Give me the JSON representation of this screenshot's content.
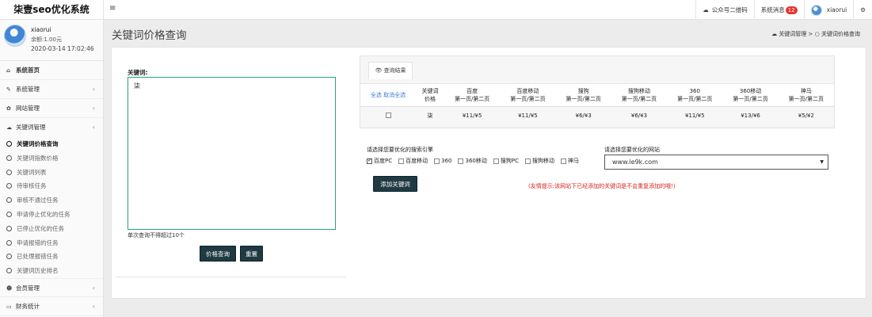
{
  "brand": "柒壹seo优化系统",
  "topbar": {
    "menu_icon": "≡",
    "qrcode": "公众号二维码",
    "messages": "系统消息",
    "messages_count": "12",
    "username": "xiaorui"
  },
  "profile": {
    "name": "xiaorui",
    "balance": "余额:1.00元",
    "time": "2020-03-14 17:02:46"
  },
  "sidebar": {
    "items": [
      {
        "label": "系统首页"
      },
      {
        "label": "系统管理"
      },
      {
        "label": "网站管理"
      },
      {
        "label": "关键词管理"
      }
    ],
    "subitems": [
      {
        "label": "关键词价格查询"
      },
      {
        "label": "关键词指数价格"
      },
      {
        "label": "关键词列表"
      },
      {
        "label": "待审核任务"
      },
      {
        "label": "审核不通过任务"
      },
      {
        "label": "申请停止优化的任务"
      },
      {
        "label": "已停止优化的任务"
      },
      {
        "label": "申请报错的任务"
      },
      {
        "label": "已处理报错任务"
      },
      {
        "label": "关键词历史排名"
      }
    ],
    "bottom_items": [
      {
        "label": "会员管理"
      },
      {
        "label": "财务统计"
      }
    ]
  },
  "page": {
    "title": "关键词价格查询",
    "breadcrumb_parent": "关键词管理",
    "breadcrumb_sep": ">",
    "breadcrumb_current": "关键词价格查询"
  },
  "form": {
    "keyword_label": "关键词:",
    "keyword_value": "柒",
    "help_text": "单次查询不得超过10个",
    "query_button": "价格查询",
    "reset_button": "重置"
  },
  "results": {
    "tab_label": "查询结果",
    "select_all": "全选",
    "deselect_all": "取消全选",
    "headers": [
      {
        "line1": "关键词",
        "line2": "价格"
      },
      {
        "line1": "百度",
        "line2": "第一页/第二页"
      },
      {
        "line1": "百度移动",
        "line2": "第一页/第二页"
      },
      {
        "line1": "搜狗",
        "line2": "第一页/第二页"
      },
      {
        "line1": "搜狗移动",
        "line2": "第一页/第二页"
      },
      {
        "line1": "360",
        "line2": "第一页/第二页"
      },
      {
        "line1": "360移动",
        "line2": "第一页/第二页"
      },
      {
        "line1": "神马",
        "line2": "第一页/第二页"
      }
    ],
    "rows": [
      [
        "柒",
        "¥11/¥5",
        "¥11/¥5",
        "¥6/¥3",
        "¥6/¥3",
        "¥11/¥5",
        "¥13/¥6",
        "¥5/¥2"
      ]
    ]
  },
  "engines": {
    "label": "请选择您要优化的搜索引擎",
    "options": [
      {
        "label": "百度PC",
        "checked": true
      },
      {
        "label": "百度移动",
        "checked": false
      },
      {
        "label": "360",
        "checked": false
      },
      {
        "label": "360移动",
        "checked": false
      },
      {
        "label": "搜狗PC",
        "checked": false
      },
      {
        "label": "搜狗移动",
        "checked": false
      },
      {
        "label": "神马",
        "checked": false
      }
    ]
  },
  "site": {
    "label": "请选择您要优化的网站",
    "selected": "www.le9k.com"
  },
  "add_button": "添加关键词",
  "tip": "(友情提示:该网站下已经添加的关键词是不会重复添加的哦!)"
}
